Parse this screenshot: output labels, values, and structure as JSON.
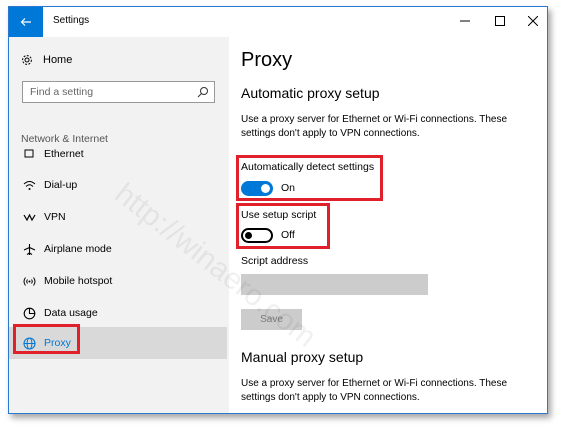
{
  "window": {
    "title": "Settings",
    "controls": [
      "minimize-icon",
      "maximize-icon",
      "close-icon"
    ]
  },
  "sidebar": {
    "home_label": "Home",
    "search_placeholder": "Find a setting",
    "section_label": "Network & Internet",
    "items": [
      {
        "label": "Ethernet",
        "icon": "ethernet-icon"
      },
      {
        "label": "Dial-up",
        "icon": "dialup-icon"
      },
      {
        "label": "VPN",
        "icon": "vpn-icon"
      },
      {
        "label": "Airplane mode",
        "icon": "airplane-icon"
      },
      {
        "label": "Mobile hotspot",
        "icon": "hotspot-icon"
      },
      {
        "label": "Data usage",
        "icon": "data-usage-icon"
      },
      {
        "label": "Proxy",
        "icon": "globe-icon",
        "selected": true
      }
    ]
  },
  "main": {
    "title": "Proxy",
    "auto_heading": "Automatic proxy setup",
    "auto_desc": "Use a proxy server for Ethernet or Wi-Fi connections. These settings don't apply to VPN connections.",
    "auto_detect_label": "Automatically detect settings",
    "auto_detect_state": "On",
    "setup_script_label": "Use setup script",
    "setup_script_state": "Off",
    "script_address_label": "Script address",
    "save_label": "Save",
    "manual_heading": "Manual proxy setup",
    "manual_desc": "Use a proxy server for Ethernet or Wi-Fi connections. These settings don't apply to VPN connections."
  },
  "watermark": "http://winaero.com",
  "colors": {
    "accent": "#0078d7",
    "highlight": "#e0202b"
  }
}
